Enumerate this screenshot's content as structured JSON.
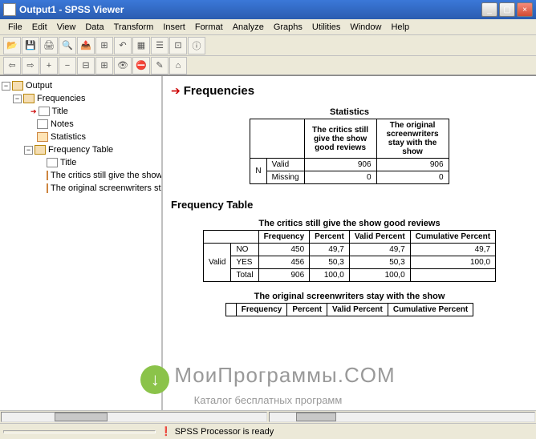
{
  "window": {
    "title": "Output1 - SPSS Viewer"
  },
  "menu": [
    "File",
    "Edit",
    "View",
    "Data",
    "Transform",
    "Insert",
    "Format",
    "Analyze",
    "Graphs",
    "Utilities",
    "Window",
    "Help"
  ],
  "tree": {
    "root": "Output",
    "items": {
      "frequencies": "Frequencies",
      "title1": "Title",
      "notes": "Notes",
      "statistics": "Statistics",
      "freqtable": "Frequency Table",
      "title2": "Title",
      "critics": "The critics still give the show g",
      "screenwriters": "The original screenwriters stay"
    }
  },
  "viewer": {
    "heading": "Frequencies",
    "stats_title": "Statistics",
    "stats_cols": {
      "col1": "The critics still give the show good reviews",
      "col2": "The original screenwriters stay with the show"
    },
    "stats_rows": {
      "n": "N",
      "valid": "Valid",
      "missing": "Missing",
      "valid_c1": "906",
      "valid_c2": "906",
      "missing_c1": "0",
      "missing_c2": "0"
    },
    "freq_heading": "Frequency Table",
    "table1_title": "The critics still give the show good reviews",
    "table2_title": "The original screenwriters stay with the show",
    "freq_headers": {
      "frequency": "Frequency",
      "percent": "Percent",
      "valid_percent": "Valid Percent",
      "cum_percent": "Cumulative Percent"
    },
    "table1": {
      "valid": "Valid",
      "no": "NO",
      "yes": "YES",
      "total": "Total",
      "r1": {
        "f": "450",
        "p": "49,7",
        "vp": "49,7",
        "cp": "49,7"
      },
      "r2": {
        "f": "456",
        "p": "50,3",
        "vp": "50,3",
        "cp": "100,0"
      },
      "r3": {
        "f": "906",
        "p": "100,0",
        "vp": "100,0",
        "cp": ""
      }
    }
  },
  "status": {
    "ready": "SPSS Processor  is ready"
  },
  "watermark": {
    "line1": "МоиПрограммы.COM",
    "line2": "Каталог бесплатных программ"
  }
}
